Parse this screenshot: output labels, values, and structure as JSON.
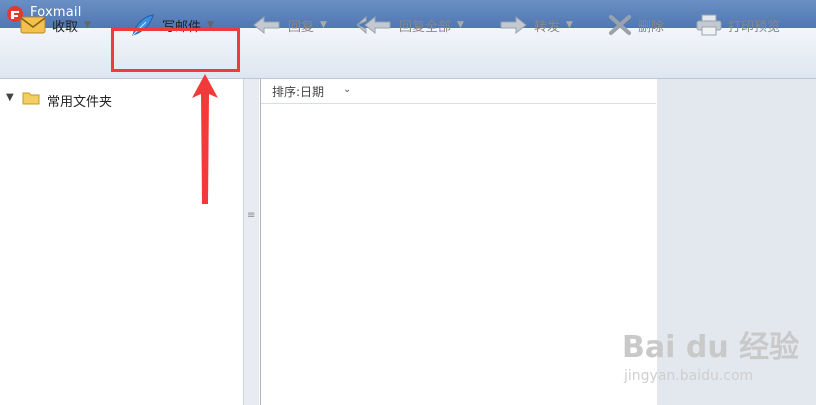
{
  "app": {
    "title": "Foxmail"
  },
  "toolbar": {
    "receive": "收取",
    "compose": "写邮件",
    "reply": "回复",
    "reply_all": "回复全部",
    "forward": "转发",
    "delete": "删除",
    "print_preview": "打印预览"
  },
  "folders": {
    "common": "常用文件夹"
  },
  "list": {
    "sort_label": "排序:日期"
  },
  "watermark": {
    "brand": "Bai du 经验",
    "url": "jingyan.baidu.com"
  },
  "colors": {
    "highlight": "#ef3b3b",
    "titlebar": "#5b80b9"
  }
}
